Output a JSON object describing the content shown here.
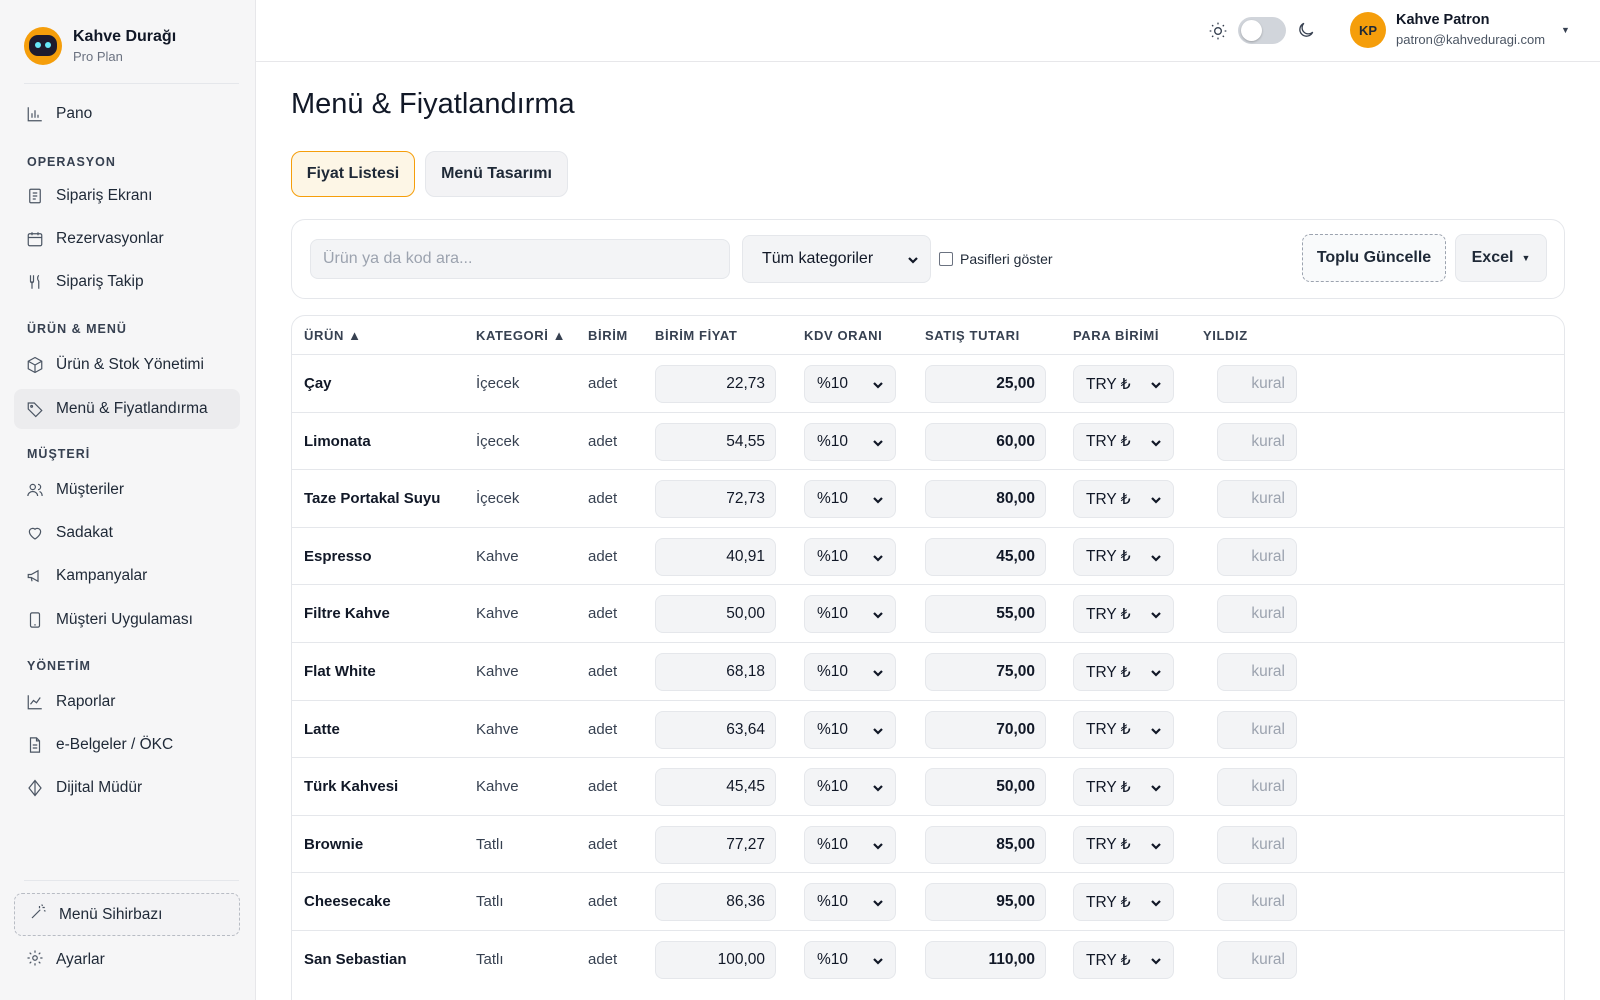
{
  "brand": {
    "name": "Kahve Durağı",
    "plan": "Pro Plan"
  },
  "sidebar": {
    "pano": "Pano",
    "sections": {
      "operasyon": "OPERASYON",
      "urun_menu": "ÜRÜN & MENÜ",
      "musteri": "MÜŞTERİ",
      "yonetim": "YÖNETİM"
    },
    "items": {
      "siparis_ekrani": "Sipariş Ekranı",
      "rezervasyonlar": "Rezervasyonlar",
      "siparis_takip": "Sipariş Takip",
      "urun_stok": "Ürün & Stok Yönetimi",
      "menu_fiyat": "Menü & Fiyatlandırma",
      "musteriler": "Müşteriler",
      "sadakat": "Sadakat",
      "kampanyalar": "Kampanyalar",
      "musteri_uygulamasi": "Müşteri Uygulaması",
      "raporlar": "Raporlar",
      "ebelgeler": "e-Belgeler / ÖKC",
      "dijital_mudur": "Dijital Müdür"
    },
    "wizard": "Menü Sihirbazı",
    "settings": "Ayarlar"
  },
  "user": {
    "initials": "KP",
    "name": "Kahve Patron",
    "email": "patron@kahveduragi.com"
  },
  "page": {
    "title": "Menü & Fiyatlandırma"
  },
  "tabs": {
    "price_list": "Fiyat Listesi",
    "menu_design": "Menü Tasarımı"
  },
  "filters": {
    "search_placeholder": "Ürün ya da kod ara...",
    "category_value": "Tüm kategoriler",
    "passive_label": "Pasifleri göster",
    "bulk_update": "Toplu Güncelle",
    "excel": "Excel"
  },
  "table": {
    "headers": {
      "product": "ÜRÜN ▲",
      "category": "KATEGORİ ▲",
      "unit": "BİRİM",
      "unit_price": "BİRİM FİYAT",
      "vat": "KDV ORANI",
      "sale_total": "SATIŞ TUTARI",
      "currency": "PARA BİRİMİ",
      "star": "YILDIZ"
    },
    "rows": [
      {
        "name": "Çay",
        "category": "İçecek",
        "unit": "adet",
        "unit_price": "22,73",
        "vat": "%10",
        "sale_total": "25,00",
        "currency": "TRY ₺",
        "star": "kural"
      },
      {
        "name": "Limonata",
        "category": "İçecek",
        "unit": "adet",
        "unit_price": "54,55",
        "vat": "%10",
        "sale_total": "60,00",
        "currency": "TRY ₺",
        "star": "kural"
      },
      {
        "name": "Taze Portakal Suyu",
        "category": "İçecek",
        "unit": "adet",
        "unit_price": "72,73",
        "vat": "%10",
        "sale_total": "80,00",
        "currency": "TRY ₺",
        "star": "kural"
      },
      {
        "name": "Espresso",
        "category": "Kahve",
        "unit": "adet",
        "unit_price": "40,91",
        "vat": "%10",
        "sale_total": "45,00",
        "currency": "TRY ₺",
        "star": "kural"
      },
      {
        "name": "Filtre Kahve",
        "category": "Kahve",
        "unit": "adet",
        "unit_price": "50,00",
        "vat": "%10",
        "sale_total": "55,00",
        "currency": "TRY ₺",
        "star": "kural"
      },
      {
        "name": "Flat White",
        "category": "Kahve",
        "unit": "adet",
        "unit_price": "68,18",
        "vat": "%10",
        "sale_total": "75,00",
        "currency": "TRY ₺",
        "star": "kural"
      },
      {
        "name": "Latte",
        "category": "Kahve",
        "unit": "adet",
        "unit_price": "63,64",
        "vat": "%10",
        "sale_total": "70,00",
        "currency": "TRY ₺",
        "star": "kural"
      },
      {
        "name": "Türk Kahvesi",
        "category": "Kahve",
        "unit": "adet",
        "unit_price": "45,45",
        "vat": "%10",
        "sale_total": "50,00",
        "currency": "TRY ₺",
        "star": "kural"
      },
      {
        "name": "Brownie",
        "category": "Tatlı",
        "unit": "adet",
        "unit_price": "77,27",
        "vat": "%10",
        "sale_total": "85,00",
        "currency": "TRY ₺",
        "star": "kural"
      },
      {
        "name": "Cheesecake",
        "category": "Tatlı",
        "unit": "adet",
        "unit_price": "86,36",
        "vat": "%10",
        "sale_total": "95,00",
        "currency": "TRY ₺",
        "star": "kural"
      },
      {
        "name": "San Sebastian",
        "category": "Tatlı",
        "unit": "adet",
        "unit_price": "100,00",
        "vat": "%10",
        "sale_total": "110,00",
        "currency": "TRY ₺",
        "star": "kural"
      }
    ]
  },
  "colors": {
    "accent": "#f59e0b",
    "sidebar_bg": "#f6f6f7",
    "active_tab_bg": "#fdf6e6"
  }
}
